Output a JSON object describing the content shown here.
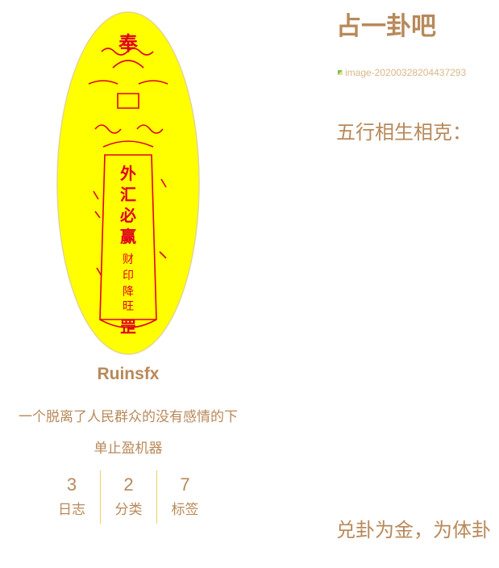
{
  "colors": {
    "accent": "#b8895a",
    "avatar_background": "#ffff00",
    "talisman_ink": "#e0001a",
    "divider": "#f0d060"
  },
  "author": {
    "avatar_icon": "talisman-avatar-icon",
    "name": "Ruinsfx",
    "description_line1": "一个脱离了人民群众的没有感情的下",
    "description_line2": "单止盈机器"
  },
  "stats": [
    {
      "count": "3",
      "label": "日志"
    },
    {
      "count": "2",
      "label": "分类"
    },
    {
      "count": "7",
      "label": "标签"
    }
  ],
  "post": {
    "title": "占一卦吧",
    "broken_image_alt": "image-20200328204437293",
    "section_heading": "五行相生相克：",
    "body_text": "兑卦为金，为体卦"
  },
  "avatar_talisman": {
    "top_char": "奉",
    "center_lines": [
      "外",
      "汇",
      "必",
      "赢"
    ],
    "lower_lines": [
      "财",
      "印",
      "降",
      "旺"
    ],
    "bottom_char": "罡"
  }
}
